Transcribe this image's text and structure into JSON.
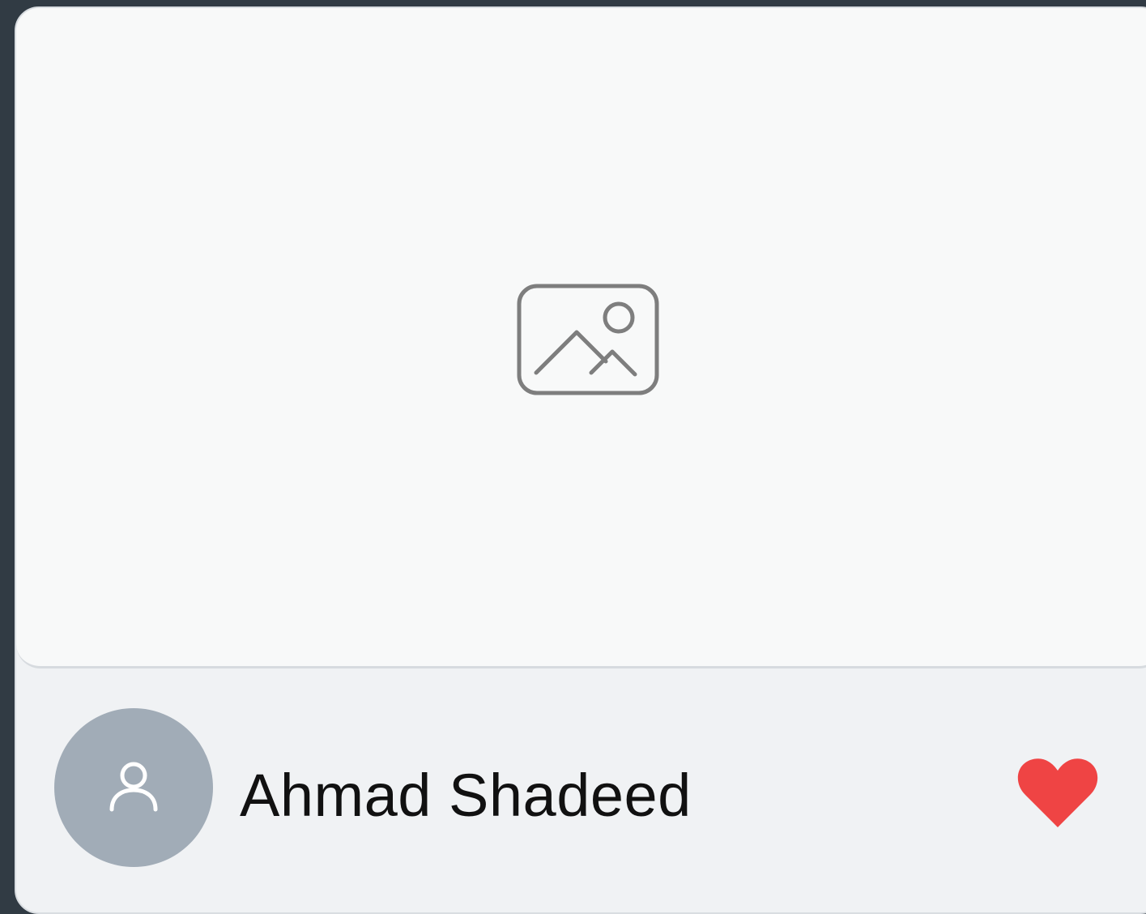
{
  "card": {
    "thumbnail": {
      "icon": "image-placeholder-icon"
    },
    "author": {
      "avatar_icon": "user-icon",
      "name": "Ahmad Shadeed"
    },
    "like": {
      "icon": "heart-icon",
      "color": "#ef4444"
    }
  },
  "colors": {
    "page_background": "#313b44",
    "card_background": "#f0f2f4",
    "thumbnail_background": "#f8f9f9",
    "avatar_background": "#a1acb7"
  }
}
